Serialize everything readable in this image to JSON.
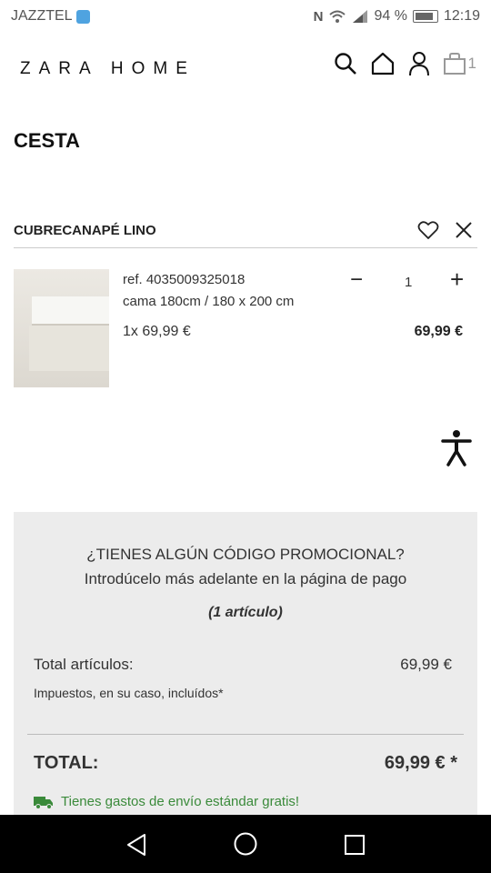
{
  "status_bar": {
    "carrier": "JAZZTEL",
    "battery": "94 %",
    "time": "12:19",
    "icons": [
      "nfc-icon",
      "wifi-icon",
      "signal-icon",
      "battery-icon"
    ]
  },
  "header": {
    "logo": "ZARA HOME",
    "icons": [
      "search-icon",
      "home-icon",
      "user-icon",
      "bag-icon"
    ],
    "cart_count": "1"
  },
  "page": {
    "title": "CESTA"
  },
  "product": {
    "name": "CUBRECANAPÉ LINO",
    "ref": "ref. 4035009325018",
    "size": "cama 180cm / 180 x 200 cm",
    "unit_price": "1x 69,99 €",
    "line_total": "69,99 €",
    "quantity": "1",
    "minus": "−",
    "plus": "+"
  },
  "summary": {
    "promo_question": "¿TIENES ALGÚN CÓDIGO PROMOCIONAL?",
    "promo_hint": "Introdúcelo más adelante en la página de pago",
    "item_count": "(1 artículo)",
    "subtotal_label": "Total artículos:",
    "subtotal_value": "69,99 €",
    "tax_note": "Impuestos, en su caso, incluídos*",
    "total_label": "TOTAL:",
    "total_value": "69,99 € *",
    "shipping_note": "Tienes gastos de envío estándar gratis!"
  },
  "colors": {
    "summary_bg": "#ececec",
    "shipping_green": "#3a8a3a",
    "nav_bg": "#000000"
  }
}
